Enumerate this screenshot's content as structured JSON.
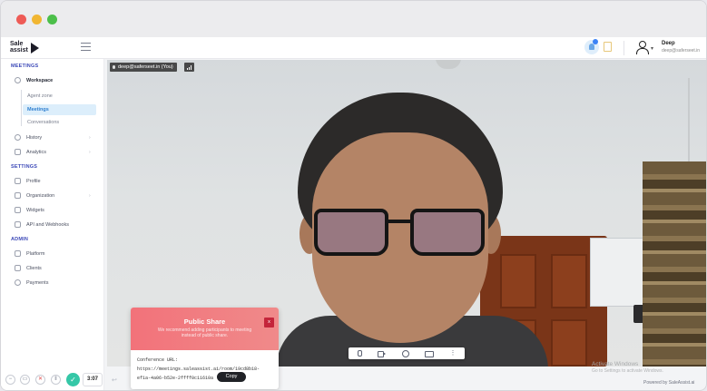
{
  "app": {
    "logo_line1": "Sale",
    "logo_line2": "assist"
  },
  "header": {
    "user_name": "Deep",
    "user_email": "deep@saferseet.in"
  },
  "sidebar": {
    "sections": [
      "MEETINGS",
      "SETTINGS",
      "ADMIN"
    ],
    "workspace": "Workspace",
    "workspace_items": [
      "Agent zone",
      "Meetings",
      "Conversations"
    ],
    "history": "History",
    "analytics": "Analytics",
    "settings_items": [
      "Profile",
      "Organization",
      "Widgets",
      "API and Webhooks"
    ],
    "admin_items": [
      "Platform",
      "Clients",
      "Payments"
    ]
  },
  "video": {
    "participant_label": "deep@saferseet.in (You)"
  },
  "public_share": {
    "title": "Public Share",
    "subtitle": "We recommend adding participants to meeting instead of public share.",
    "close": "x",
    "label": "Conference URL:",
    "url": "https://meetings.saleassist.ai/room/19cd8b18-ef1a-4a06-b52e-2ffff0c11610a",
    "copy_label": "Copy"
  },
  "call": {
    "timer": "3:07"
  },
  "watermark": {
    "line1": "Activate Windows",
    "line2": "Go to Settings to activate Windows."
  },
  "footer": {
    "powered_by": "Powered by SaleAssist.ai"
  },
  "colors": {
    "accent": "#3d4ab8",
    "share_header": "#f2727a",
    "end_call": "#35c7a7"
  }
}
